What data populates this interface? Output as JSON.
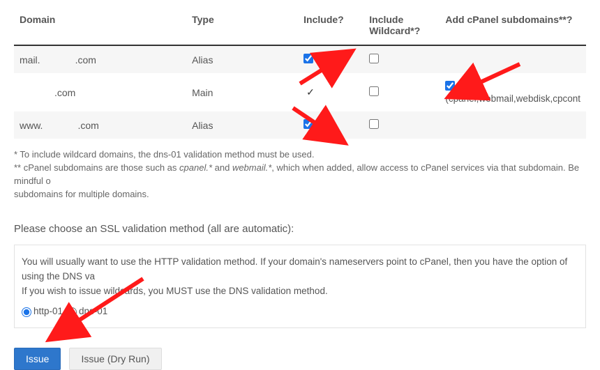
{
  "table": {
    "headers": {
      "domain": "Domain",
      "type": "Type",
      "include": "Include?",
      "wildcard": "Include Wildcard*?",
      "subdomains": "Add cPanel subdomains**?"
    },
    "rows": [
      {
        "domain_prefix": "mail.",
        "domain_suffix": ".com",
        "type": "Alias",
        "include_fixed": false,
        "include_checked": true,
        "wildcard_checked": false,
        "sub_checked": false,
        "sub_label": ""
      },
      {
        "domain_prefix": "",
        "domain_suffix": ".com",
        "type": "Main",
        "include_fixed": true,
        "include_checked": true,
        "wildcard_checked": false,
        "sub_checked": true,
        "sub_label": "(cpanel,webmail,webdisk,cpcont"
      },
      {
        "domain_prefix": "www.",
        "domain_suffix": ".com",
        "type": "Alias",
        "include_fixed": false,
        "include_checked": true,
        "wildcard_checked": false,
        "sub_checked": false,
        "sub_label": ""
      }
    ]
  },
  "footnotes": {
    "l1": "* To include wildcard domains, the dns-01 validation method must be used.",
    "l2a": "** cPanel subdomains are those such as ",
    "l2b": "cpanel.*",
    "l2c": " and ",
    "l2d": "webmail.*",
    "l2e": ", which when added, allow access to cPanel services via that subdomain. Be mindful o",
    "l3": "subdomains for multiple domains."
  },
  "section_title": "Please choose an SSL validation method (all are automatic):",
  "info": {
    "l1": "You will usually want to use the HTTP validation method. If your domain's nameservers point to cPanel, then you have the option of using the DNS va",
    "l2": "If you wish to issue wildcards, you MUST use the DNS validation method."
  },
  "radios": {
    "http": "http-01",
    "dns": "dns-01"
  },
  "buttons": {
    "issue": "Issue",
    "dryrun": "Issue (Dry Run)"
  }
}
